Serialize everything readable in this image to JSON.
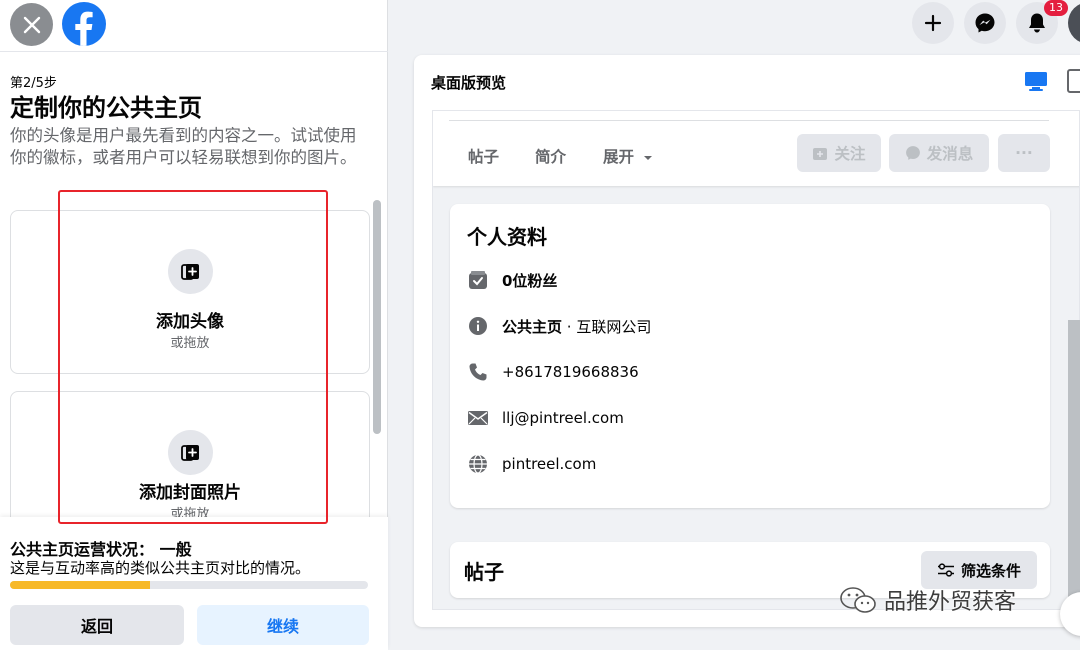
{
  "wizard": {
    "step": "第2/5步",
    "title": "定制你的公共主页",
    "description": "你的头像是用户最先看到的内容之一。试试使用你的徽标，或者用户可以轻易联想到你的图片。",
    "avatar_upload": {
      "label": "添加头像",
      "sub": "或拖放"
    },
    "cover_upload": {
      "label": "添加封面照片",
      "sub": "或拖放"
    },
    "health": {
      "title": "公共主页运营状况：  一般",
      "description": "这是与互动率高的类似公共主页对比的情况。",
      "progress": 0.39,
      "color": "#f7b928"
    },
    "back_label": "返回",
    "next_label": "继续"
  },
  "topnav": {
    "icons": [
      "plus-icon",
      "messenger-icon",
      "bell-icon"
    ],
    "notification_count": "13"
  },
  "preview": {
    "title": "桌面版预览",
    "tabs": [
      "帖子",
      "简介",
      "展开"
    ],
    "follow_label": "关注",
    "message_label": "发消息",
    "more_label": "···",
    "profile": {
      "title": "个人资料",
      "followers": "0位粉丝",
      "category_bold": "公共主页",
      "category_rest": " · 互联网公司",
      "phone": "+8617819668836",
      "email": "llj@pintreel.com",
      "website": "pintreel.com"
    },
    "posts": {
      "title": "帖子",
      "filter_label": "筛选条件"
    }
  },
  "watermark": "品推外贸获客",
  "colors": {
    "brand": "#1877f2",
    "annotation": "#e8242b",
    "badge": "#e41e3f"
  }
}
